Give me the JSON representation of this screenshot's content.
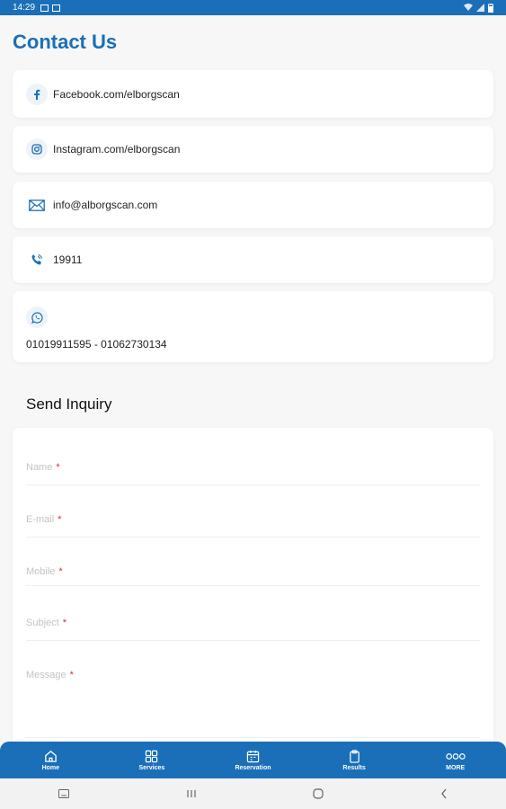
{
  "status_bar": {
    "time": "14:29"
  },
  "page": {
    "title": "Contact Us"
  },
  "contacts": {
    "facebook": "Facebook.com/elborgscan",
    "instagram": "Instagram.com/elborgscan",
    "email": "info@alborgscan.com",
    "phone": "19911",
    "whatsapp": "01019911595 - 01062730134"
  },
  "inquiry": {
    "title": "Send Inquiry",
    "fields": [
      {
        "placeholder": "Name",
        "required": "*"
      },
      {
        "placeholder": "E-mail",
        "required": "*"
      },
      {
        "placeholder": "Mobile",
        "required": "*"
      },
      {
        "placeholder": "Subject",
        "required": "*"
      },
      {
        "placeholder": "Message",
        "required": "*"
      }
    ]
  },
  "bottom_nav": {
    "items": [
      {
        "label": "Home",
        "icon": "home-icon"
      },
      {
        "label": "Services",
        "icon": "grid-icon"
      },
      {
        "label": "Reservation",
        "icon": "calendar-icon"
      },
      {
        "label": "Results",
        "icon": "clipboard-icon"
      },
      {
        "label": "MORE",
        "icon": "more-icon"
      }
    ]
  },
  "colors": {
    "primary": "#1a6fb8",
    "required": "#d32f2f"
  }
}
